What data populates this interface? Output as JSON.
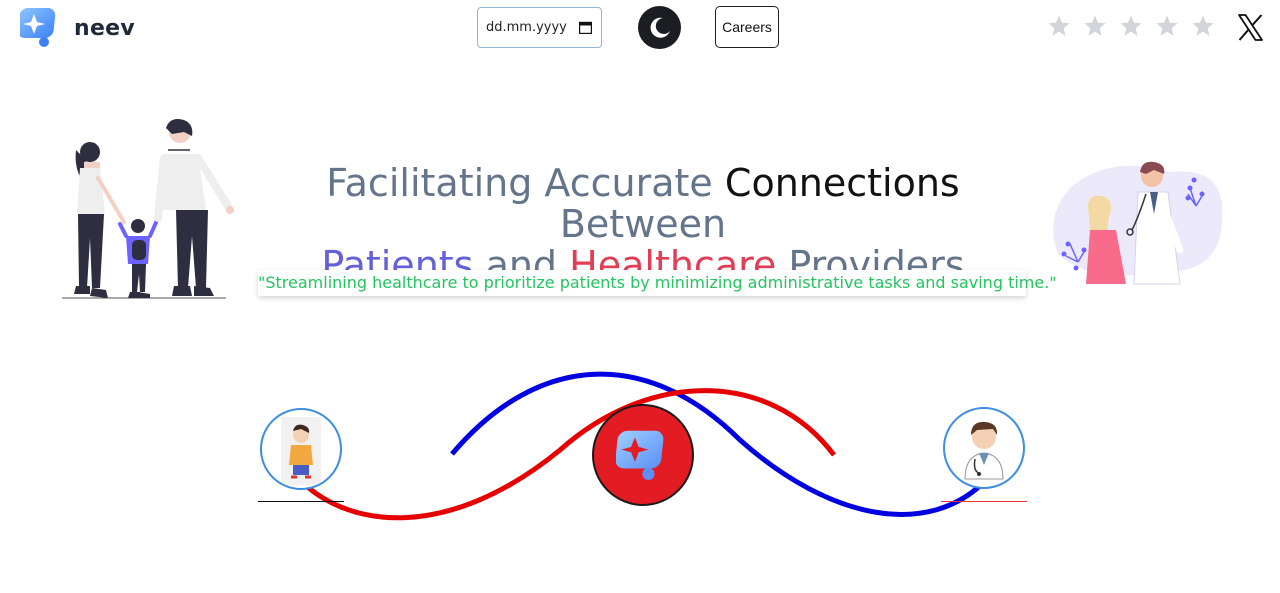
{
  "header": {
    "brand": "neev",
    "date_placeholder": "dd.mm.yyyy",
    "careers_label": "Careers",
    "rating_stars": 5,
    "rating_value": 0
  },
  "hero": {
    "headline": {
      "part1": "Facilitating Accurate ",
      "part2": "Connections",
      "part3": " Between",
      "part4": "Patients",
      "part5": " and ",
      "part6": "Healthcare",
      "part7": " Providers"
    },
    "tagline": "\"Streamlining healthcare to prioritize patients by minimizing administrative tasks and saving time.\""
  },
  "colors": {
    "tagline_green": "#22c55e",
    "accent_purple": "#6461d8",
    "accent_red": "#e13e55",
    "wave_blue": "#0000e0",
    "wave_red": "#e60000",
    "hub_red": "#e31b23",
    "avatar_border": "#3b8ee0"
  },
  "icons": {
    "logo": "neev-logo-icon",
    "theme": "moon-icon",
    "calendar": "calendar-icon",
    "star": "star-icon",
    "social": "x-logo-icon"
  }
}
